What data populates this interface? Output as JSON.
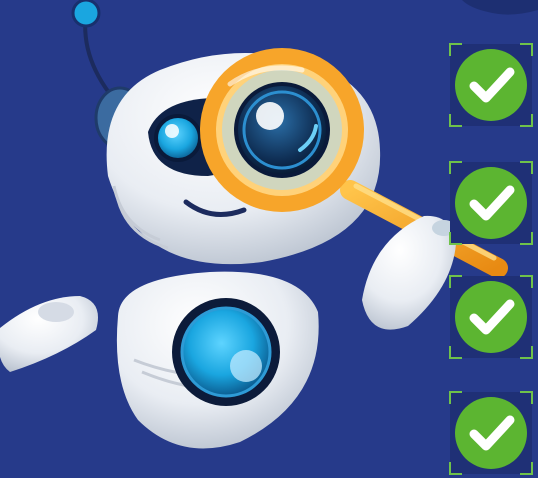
{
  "colors": {
    "background": "#263a8a",
    "check_fill": "#5cb531",
    "check_frame": "#6fc24a",
    "lens_frame": "#f39a1c",
    "eye_iris": "#1aa6e0",
    "robot_body": "#eef1f6"
  },
  "icons": {
    "robot": "robot-illustration",
    "magnifier": "magnifying-glass-icon",
    "check": "check-circle-icon"
  },
  "checklist": [
    {
      "state": "checked"
    },
    {
      "state": "checked"
    },
    {
      "state": "checked"
    },
    {
      "state": "checked"
    }
  ]
}
